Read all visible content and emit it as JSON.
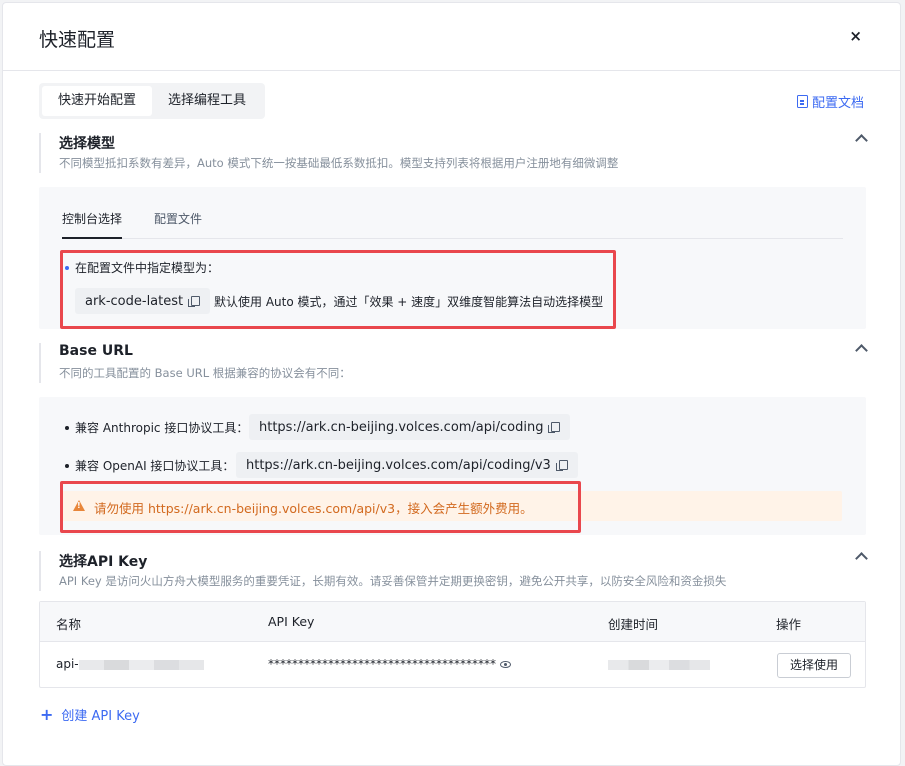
{
  "modal": {
    "title": "快速配置",
    "close_glyph": "×"
  },
  "top_tabs": [
    {
      "label": "快速开始配置",
      "active": true
    },
    {
      "label": "选择编程工具",
      "active": false
    }
  ],
  "doc_link": {
    "label": "配置文档"
  },
  "model_section": {
    "title": "选择模型",
    "description": "不同模型抵扣系数有差异，Auto 模式下统一按基础最低系数抵扣。模型支持列表将根据用户注册地有细微调整",
    "sub_tabs": [
      {
        "label": "控制台选择",
        "active": true
      },
      {
        "label": "配置文件",
        "active": false
      }
    ],
    "instruction": "在配置文件中指定模型为：",
    "model_code": "ark-code-latest",
    "model_desc": "默认使用 Auto 模式，通过「效果 + 速度」双维度智能算法自动选择模型"
  },
  "base_url_section": {
    "title": "Base URL",
    "description": "不同的工具配置的 Base URL 根据兼容的协议会有不同：",
    "anthropic_label": "兼容 Anthropic 接口协议工具：",
    "anthropic_url": "https://ark.cn-beijing.volces.com/api/coding",
    "openai_label": "兼容 OpenAI 接口协议工具：",
    "openai_url": "https://ark.cn-beijing.volces.com/api/coding/v3",
    "warning": "请勿使用 https://ark.cn-beijing.volces.com/api/v3，接入会产生额外费用。"
  },
  "api_key_section": {
    "title": "选择API Key",
    "description": "API Key 是访问火山方舟大模型服务的重要凭证，长期有效。请妥善保管并定期更换密钥，避免公开共享，以防安全风险和资金损失",
    "columns": [
      "名称",
      "API Key",
      "创建时间",
      "操作"
    ],
    "row": {
      "name_prefix": "api-",
      "masked_key": "**************************************",
      "action": "选择使用"
    }
  },
  "create_link": {
    "label": "创建 API Key"
  },
  "colors": {
    "accent": "#3c6af2",
    "warning": "#d2691e",
    "highlight_border": "#e9474d"
  }
}
